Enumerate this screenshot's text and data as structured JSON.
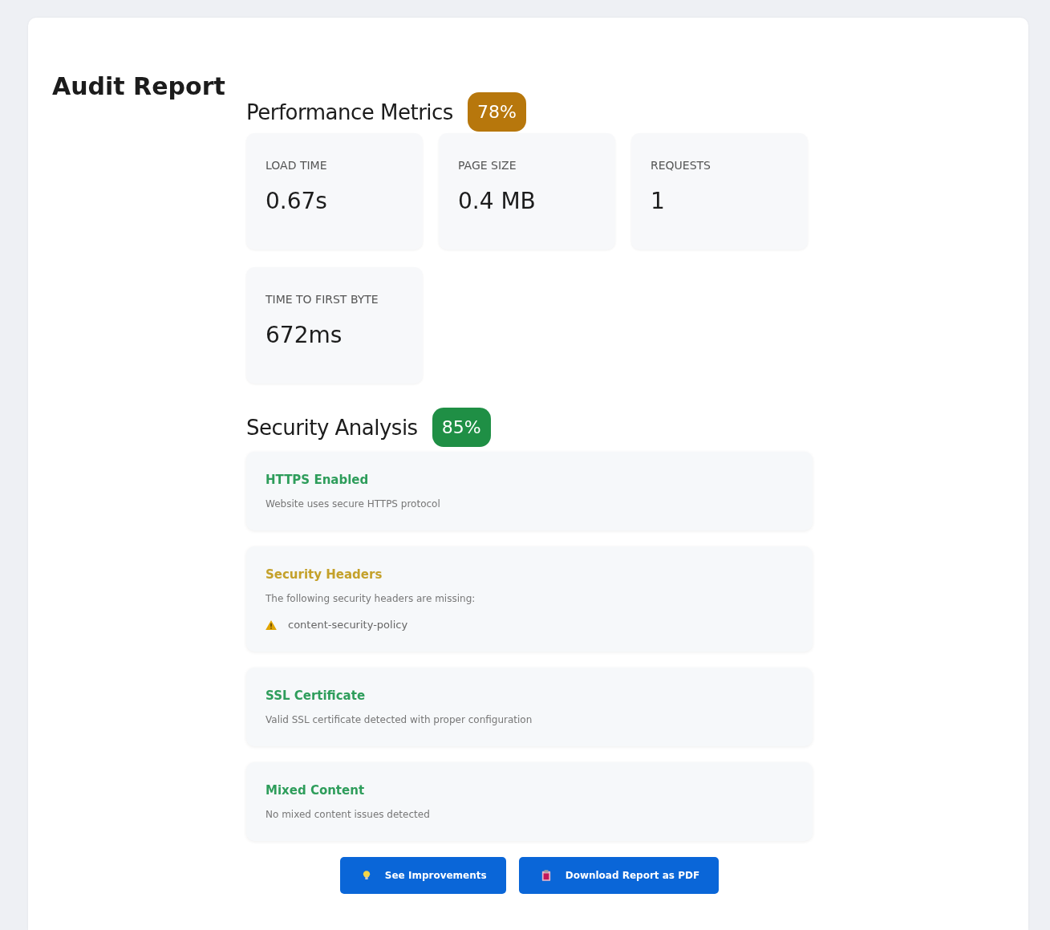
{
  "title": "Audit Report",
  "performance": {
    "heading": "Performance Metrics",
    "score": "78%",
    "color": "#b7770c",
    "metrics": [
      {
        "label": "LOAD TIME",
        "value": "0.67s"
      },
      {
        "label": "PAGE SIZE",
        "value": "0.4 MB"
      },
      {
        "label": "REQUESTS",
        "value": "1"
      },
      {
        "label": "TIME TO FIRST BYTE",
        "value": "672ms"
      }
    ]
  },
  "security": {
    "heading": "Security Analysis",
    "score": "85%",
    "color": "#1f8f45",
    "checks": [
      {
        "title": "HTTPS Enabled",
        "color": "#2e9d5b",
        "description": "Website uses secure HTTPS protocol"
      },
      {
        "title": "Security Headers",
        "color": "#c4a12a",
        "description": "The following security headers are missing:",
        "missing": [
          "content-security-policy"
        ]
      },
      {
        "title": "SSL Certificate",
        "color": "#2e9d5b",
        "description": "Valid SSL certificate detected with proper configuration"
      },
      {
        "title": "Mixed Content",
        "color": "#2e9d5b",
        "description": "No mixed content issues detected"
      }
    ]
  },
  "buttons": [
    {
      "label": "See Improvements",
      "kind": "improvements"
    },
    {
      "label": "Download Report as PDF",
      "kind": "download"
    }
  ]
}
